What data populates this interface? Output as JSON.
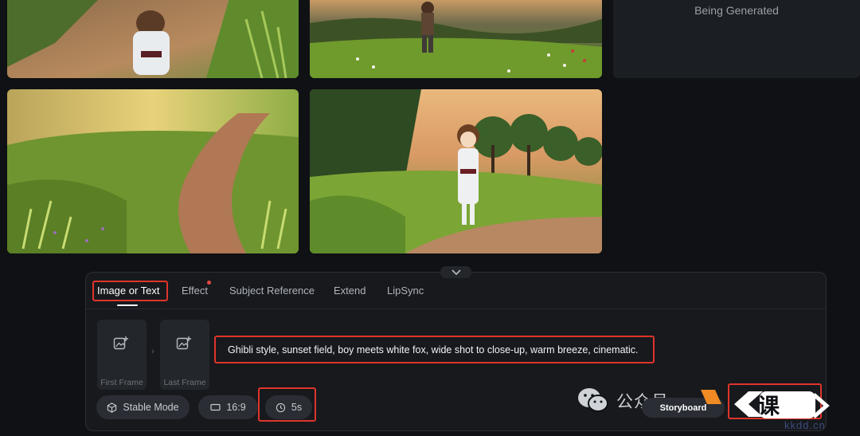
{
  "gallery": {
    "generating_label": "Being Generated"
  },
  "composer": {
    "tabs": [
      {
        "label": "Image or Text",
        "active": true
      },
      {
        "label": "Effect",
        "badge": true
      },
      {
        "label": "Subject Reference"
      },
      {
        "label": "Extend"
      },
      {
        "label": "LipSync"
      }
    ],
    "first_frame_label": "First Frame",
    "last_frame_label": "Last Frame",
    "prompt": "Ghibli style, sunset field, boy meets white fox, wide shot to close-up, warm breeze, cinematic.",
    "mode_label": "Stable Mode",
    "ratio_label": "16:9",
    "duration_label": "5s",
    "storyboard_label": "Storyboard"
  },
  "watermark": {
    "wechat_text": "公众号",
    "logo_text": "课",
    "site_text": "kkdd.cn"
  },
  "colors": {
    "highlight": "#e0352b",
    "badge": "#e5483f",
    "panel": "#17191d",
    "page": "#0f1114"
  }
}
